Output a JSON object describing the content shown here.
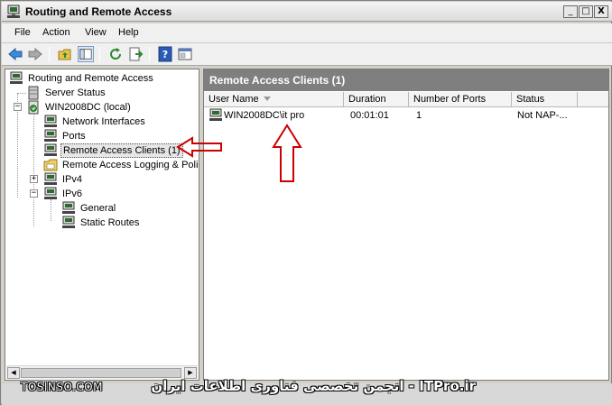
{
  "window": {
    "title": "Routing and Remote Access",
    "minimize_glyph": "_",
    "maximize_glyph": "□",
    "close_glyph": "X"
  },
  "menu": {
    "items": [
      "File",
      "Action",
      "View",
      "Help"
    ]
  },
  "toolbar": {
    "icons": [
      "back-icon",
      "forward-icon",
      "up-folder-icon",
      "show-hide-tree-icon",
      "refresh-icon",
      "export-list-icon",
      "help-icon",
      "properties-icon"
    ]
  },
  "tree": {
    "items": [
      {
        "label": "Routing and Remote Access",
        "icon": "rras-icon"
      },
      {
        "label": "Server Status",
        "icon": "server-status-icon"
      },
      {
        "label": "WIN2008DC (local)",
        "icon": "server-icon",
        "expander": "−"
      },
      {
        "label": "Network Interfaces",
        "icon": "network-interfaces-icon"
      },
      {
        "label": "Ports",
        "icon": "ports-icon"
      },
      {
        "label": "Remote Access Clients (1)",
        "icon": "remote-clients-icon",
        "selected": true
      },
      {
        "label": "Remote Access Logging & Policies",
        "icon": "logging-folder-icon"
      },
      {
        "label": "IPv4",
        "icon": "ipv4-icon",
        "expander": "+"
      },
      {
        "label": "IPv6",
        "icon": "ipv6-icon",
        "expander": "−"
      },
      {
        "label": "General",
        "icon": "general-icon"
      },
      {
        "label": "Static Routes",
        "icon": "static-routes-icon"
      }
    ]
  },
  "details": {
    "header": "Remote Access Clients (1)",
    "columns": [
      "User Name",
      "Duration",
      "Number of Ports",
      "Status"
    ],
    "sorted_column": "User Name",
    "rows": [
      {
        "user": "WIN2008DC\\it pro",
        "duration": "00:01:01",
        "ports": "1",
        "status": "Not NAP-..."
      }
    ]
  },
  "watermarks": {
    "left": "TOSINSO.COM",
    "right": "ITPro.ir - انجمن تخصصی فناوری اطلاعات ایران"
  },
  "colors": {
    "annotation_arrow": "#cc0000",
    "pane_header_bg": "#7f7f7f"
  }
}
